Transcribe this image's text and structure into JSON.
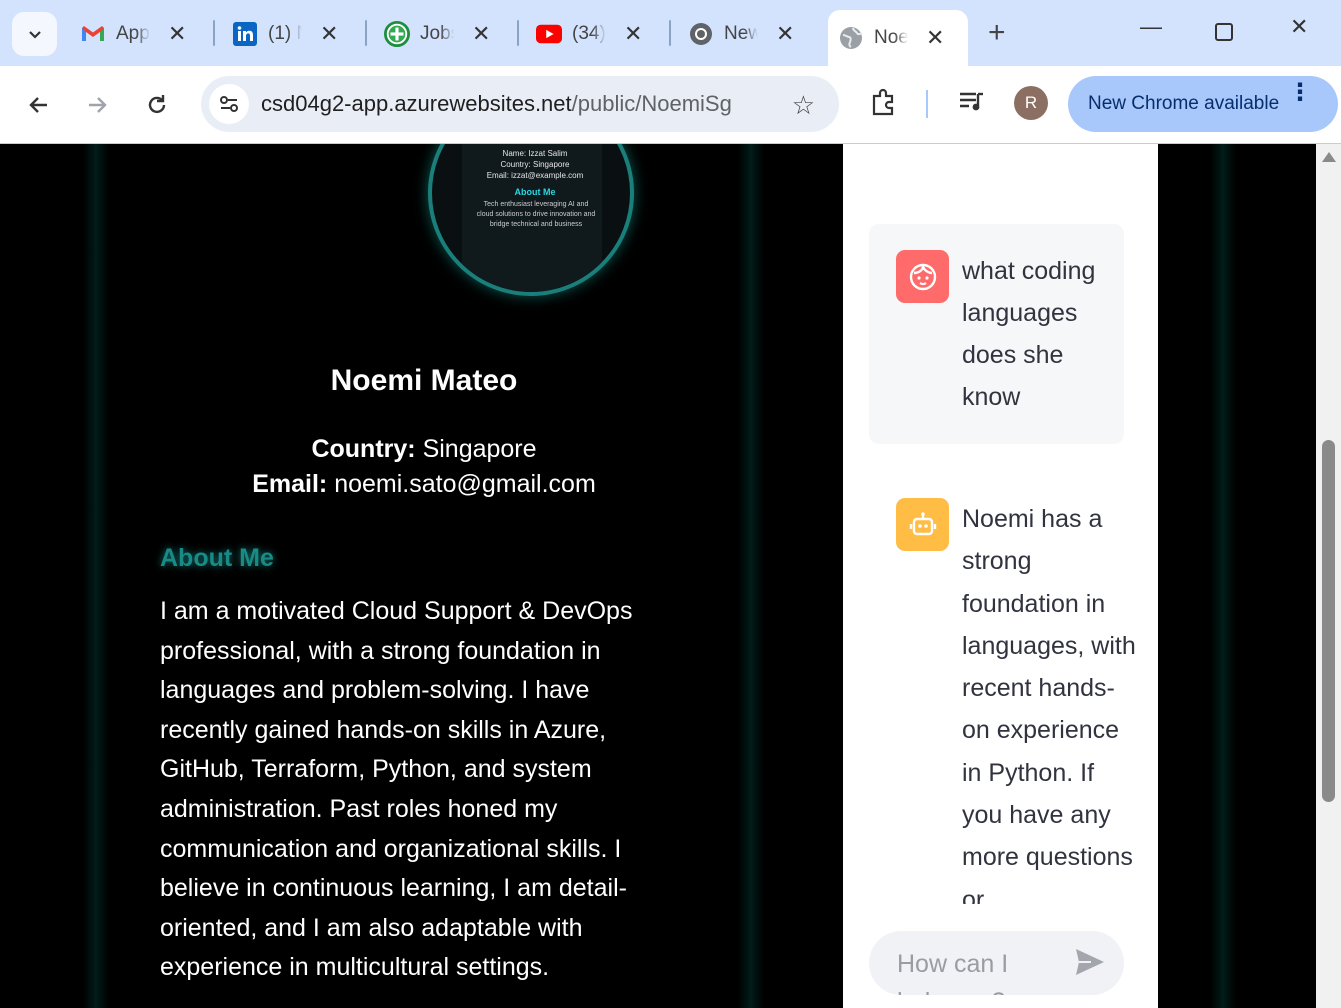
{
  "browser": {
    "tabs": [
      {
        "title": "App",
        "icon": "gmail-icon"
      },
      {
        "title": "(1) N",
        "icon": "linkedin-icon"
      },
      {
        "title": "Jobs",
        "icon": "jobs-icon"
      },
      {
        "title": "(34)",
        "icon": "youtube-icon"
      },
      {
        "title": "New",
        "icon": "chrome-icon"
      },
      {
        "title": "Noe",
        "icon": "globe-icon"
      }
    ],
    "url_host": "csd04g2-app.azurewebsites.net",
    "url_path": "/public/NoemiSg",
    "profile_initial": "R",
    "update_label": "New Chrome available"
  },
  "profile": {
    "photo_card": {
      "name_line": "Name: Izzat Salim",
      "country_line": "Country: Singapore",
      "email_line": "Email: izzat@example.com",
      "about_title": "About Me",
      "about_text": "Tech enthusiast leveraging AI and cloud solutions to drive innovation and bridge technical and business"
    },
    "name": "Noemi Mateo",
    "country_label": "Country:",
    "country_value": "Singapore",
    "email_label": "Email:",
    "email_value": "noemi.sato@gmail.com",
    "about_title": "About Me",
    "about_text": "I am a motivated Cloud Support & DevOps professional, with a strong foundation in languages and problem-solving. I have recently gained hands-on skills in Azure, GitHub, Terraform, Python, and system administration. Past roles honed my communication and organizational skills. I believe in continuous learning, I am detail-oriented, and I am also adaptable with experience in multicultural settings."
  },
  "chat": {
    "user_message": "what coding languages does she know",
    "bot_message": "Noemi has a strong foundation in languages, with recent hands-on experience in Python. If you have any more questions or",
    "input_placeholder": "How can I help you?"
  },
  "colors": {
    "accent_teal": "#178b86",
    "user_avatar": "#ff6b6b",
    "bot_avatar": "#ffbd45",
    "chrome_tabstrip": "#d3e3fd"
  }
}
